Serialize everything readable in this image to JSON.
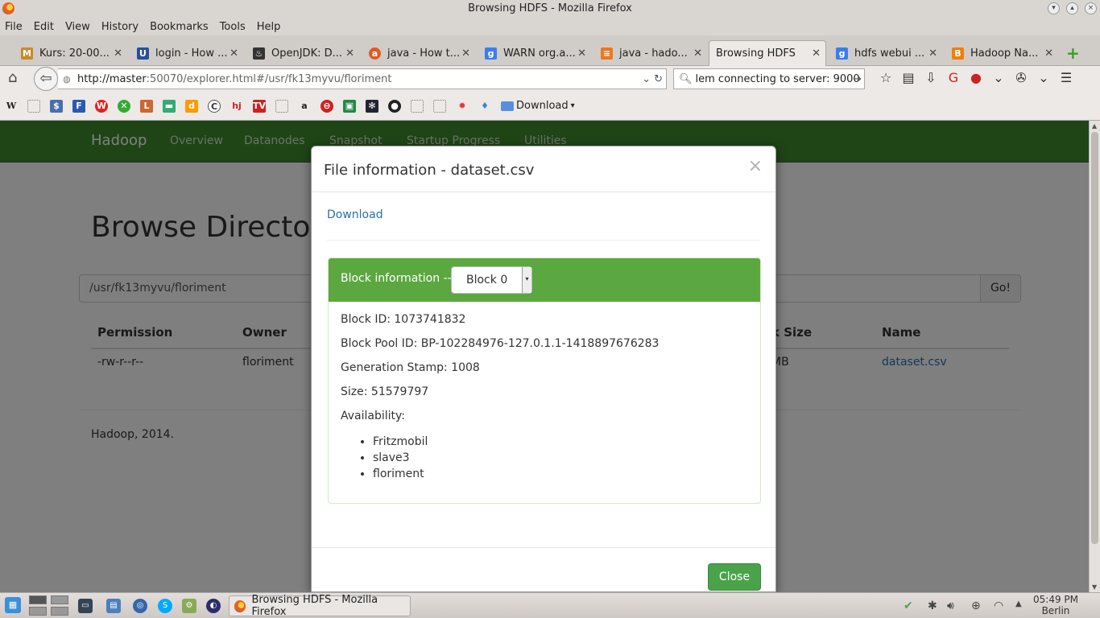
{
  "window": {
    "title": "Browsing HDFS - Mozilla Firefox"
  },
  "menu": [
    "File",
    "Edit",
    "View",
    "History",
    "Bookmarks",
    "Tools",
    "Help"
  ],
  "tabs": [
    {
      "label": "Kurs: 20-00...",
      "icon": "kurs-icon",
      "color": "#c98a2a"
    },
    {
      "label": "login - How ...",
      "icon": "ul-icon",
      "color": "#264f9e"
    },
    {
      "label": "OpenJDK: D...",
      "icon": "openjdk-icon",
      "color": "#333333"
    },
    {
      "label": "java - How t...",
      "icon": "askubuntu-icon",
      "color": "#e15a25"
    },
    {
      "label": "WARN org.a...",
      "icon": "google-icon",
      "color": "#3b7ded"
    },
    {
      "label": "java - hado...",
      "icon": "stackoverflow-icon",
      "color": "#e87a22"
    },
    {
      "label": "Browsing HDFS",
      "icon": "",
      "color": ""
    },
    {
      "label": "hdfs webui ...",
      "icon": "google-icon",
      "color": "#3b7ded"
    },
    {
      "label": "Hadoop Na...",
      "icon": "blogger-icon",
      "color": "#f57d00"
    }
  ],
  "navbar": {
    "url_host": "http://master",
    "url_rest": ":50070/explorer.html#/usr/fk13myvu/floriment",
    "search_value": "lem connecting to server: 9000"
  },
  "bookmarks": {
    "folder_label": "Download"
  },
  "page": {
    "brand": "Hadoop",
    "nav_items": [
      "Overview",
      "Datanodes",
      "Snapshot",
      "Startup Progress",
      "Utilities"
    ],
    "heading": "Browse Directory",
    "dir_value": "/usr/fk13myvu/floriment",
    "go_label": "Go!",
    "columns": {
      "permission": "Permission",
      "owner": "Owner",
      "block_size": "k Size",
      "name": "Name"
    },
    "row": {
      "permission": "-rw-r--r--",
      "owner": "floriment",
      "block_size": "MB",
      "name": "dataset.csv"
    },
    "footer": "Hadoop, 2014."
  },
  "modal": {
    "title": "File information - dataset.csv",
    "close_x": "×",
    "download_label": "Download",
    "block_label": "Block information --",
    "block_selected": "Block 0",
    "block_id": "Block ID: 1073741832",
    "block_pool_id": "Block Pool ID: BP-102284976-127.0.1.1-1418897676283",
    "generation_stamp": "Generation Stamp: 1008",
    "size": "Size: 51579797",
    "availability_label": "Availability:",
    "availability": [
      "Fritzmobil",
      "slave3",
      "floriment"
    ],
    "close_button": "Close",
    "header_color": "#5ba740"
  },
  "taskbar": {
    "task_label": "Browsing HDFS - Mozilla Firefox",
    "time": "05:49 PM",
    "location": "Berlin"
  }
}
